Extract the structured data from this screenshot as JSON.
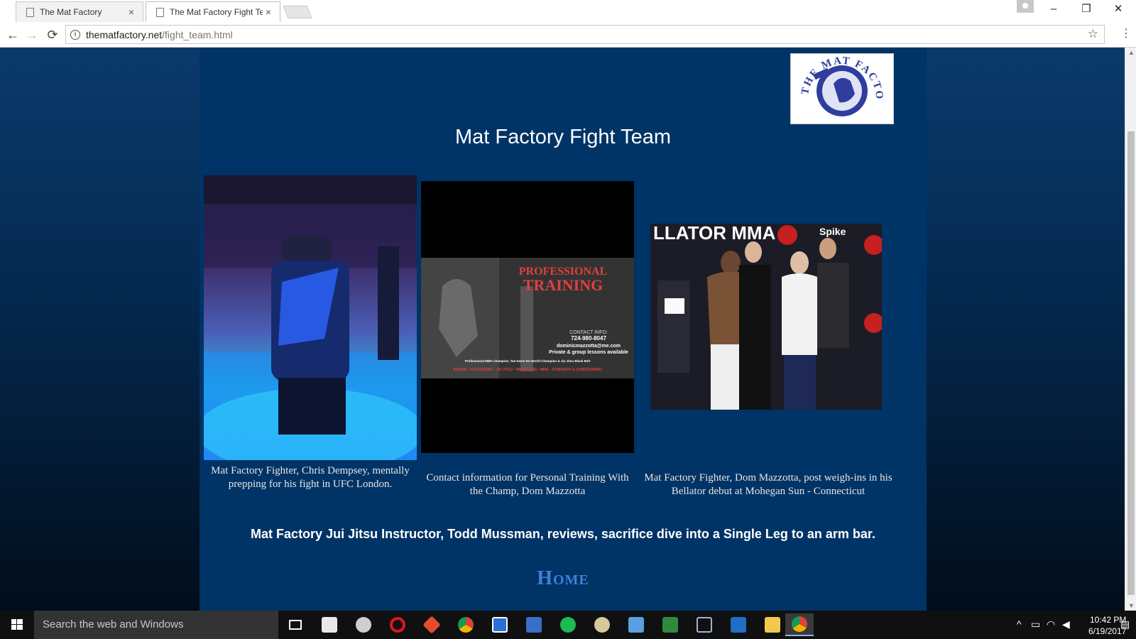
{
  "browser": {
    "tabs": [
      {
        "title": "The Mat Factory",
        "close": "×"
      },
      {
        "title": "The Mat Factory Fight Te",
        "close": "×"
      }
    ],
    "window_controls": {
      "minimize": "–",
      "maximize": "❐",
      "close": "✕"
    },
    "address": {
      "host": "thematfactory.net",
      "path": "/fight_team.html"
    },
    "nav_glyphs": {
      "back": "←",
      "forward": "→",
      "reload": "⟳",
      "star": "☆",
      "menu": "⋮",
      "info": "i"
    }
  },
  "page": {
    "title": "Mat Factory Fight Team",
    "logo": {
      "text": "THE MAT FACTORY"
    },
    "photos": [
      {
        "caption": "Mat Factory Fighter, Chris Dempsey, mentally prepping for his fight in UFC London."
      },
      {
        "caption": "Contact information for Personal Training With the Champ, Dom Mazzotta",
        "poster": {
          "headline1": "PROFESSIONAL",
          "headline2": "TRAINING",
          "contact_label": "CONTACT INFO:",
          "phone": "724-980-8047",
          "email": "dominicmazzotta@me.com",
          "lessons": "Private & group lessons available",
          "credentials": "Professional MMA champion, Tae Kwon Do World Champion & Jiu Jitsu Black Belt",
          "disciplines": "BOXING · KICKBOXING · JIU JITSU · WRESTLING · MMA · STRENGTH & CONDITIONING"
        }
      },
      {
        "caption": "Mat Factory Fighter, Dom Mazzotta, post weigh-ins in his Bellator debut at Mohegan Sun - Connecticut",
        "banner": "LLATOR MMA",
        "sponsor": "Spike"
      }
    ],
    "video_caption": "Mat Factory Jui Jitsu Instructor, Todd Mussman, reviews, sacrifice dive into a Single Leg to an arm bar.",
    "home_link": "Home"
  },
  "taskbar": {
    "search_placeholder": "Search the web and Windows",
    "apps": [
      "task-view",
      "slack",
      "github",
      "opera",
      "git",
      "chrome",
      "code-editor",
      "network",
      "spotify",
      "paint",
      "virtualbox",
      "excel",
      "package",
      "outlook",
      "file-explorer",
      "chrome-active"
    ],
    "clock": {
      "time": "10:42 PM",
      "date": "6/19/2017"
    }
  },
  "colors": {
    "page_background": "#003366",
    "home_link": "#3f7fd9",
    "title_text": "#ffffff"
  }
}
